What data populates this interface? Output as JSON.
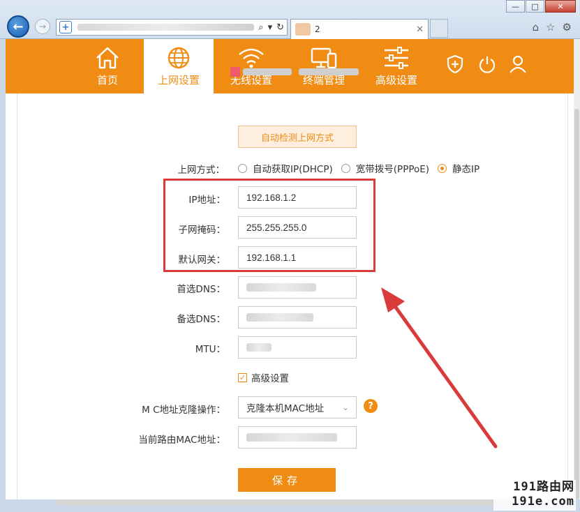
{
  "browser": {
    "tab_title": "2",
    "window_controls": [
      "—",
      "□",
      "✕"
    ],
    "right_icons": [
      "home-icon",
      "star-icon",
      "gear-icon"
    ]
  },
  "nav": {
    "items": [
      {
        "label": "首页",
        "icon": "home-icon"
      },
      {
        "label": "上网设置",
        "icon": "globe-icon",
        "active": true
      },
      {
        "label": "无线设置",
        "icon": "wifi-icon"
      },
      {
        "label": "终端管理",
        "icon": "devices-icon"
      },
      {
        "label": "高级设置",
        "icon": "sliders-icon"
      }
    ],
    "tools": [
      "shield-plus-icon",
      "power-icon",
      "user-icon"
    ]
  },
  "form": {
    "auto_detect_label": "自动检测上网方式",
    "wan_mode_label": "上网方式：",
    "wan_modes": [
      {
        "label": "自动获取IP(DHCP)",
        "selected": false
      },
      {
        "label": "宽带拨号(PPPoE)",
        "selected": false
      },
      {
        "label": "静态IP",
        "selected": true
      }
    ],
    "ip_label": "IP地址：",
    "ip_value": "192.168.1.2",
    "mask_label": "子网掩码：",
    "mask_value": "255.255.255.0",
    "gateway_label": "默认网关：",
    "gateway_value": "192.168.1.1",
    "dns1_label": "首选DNS：",
    "dns2_label": "备选DNS：",
    "mtu_label": "MTU：",
    "advanced_label": "高级设置",
    "mac_clone_label": "M  C地址克隆操作：",
    "mac_clone_value": "克隆本机MAC地址",
    "current_mac_label": "当前路由MAC地址：",
    "save_label": "保存"
  },
  "watermark": {
    "line1": "191路由网",
    "line2": "191e.com"
  },
  "colors": {
    "brand_orange": "#f08c14",
    "highlight_red": "#d93a3a"
  }
}
